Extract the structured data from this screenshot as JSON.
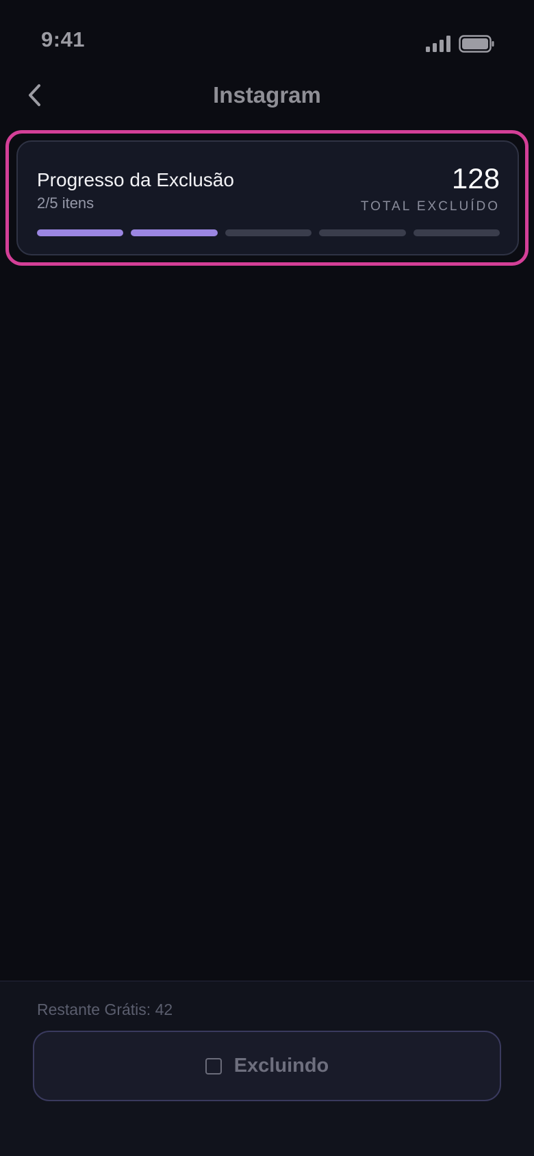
{
  "status_bar": {
    "time": "9:41",
    "signal_icon": "cellular-signal-icon",
    "battery_icon": "battery-icon"
  },
  "nav": {
    "back_icon": "chevron-left-icon",
    "title": "Instagram"
  },
  "progress_card": {
    "title": "Progresso da Exclusão",
    "subtitle": "2/5 itens",
    "total_count": "128",
    "total_label": "TOTAL EXCLUÍDO",
    "segments_total": 5,
    "segments_completed": 2,
    "highlight_color": "#d43f97",
    "fill_color": "#9b86e2"
  },
  "footer": {
    "free_remaining": "Restante Grátis: 42",
    "button_icon": "stop-square-icon",
    "button_label": "Excluindo"
  }
}
